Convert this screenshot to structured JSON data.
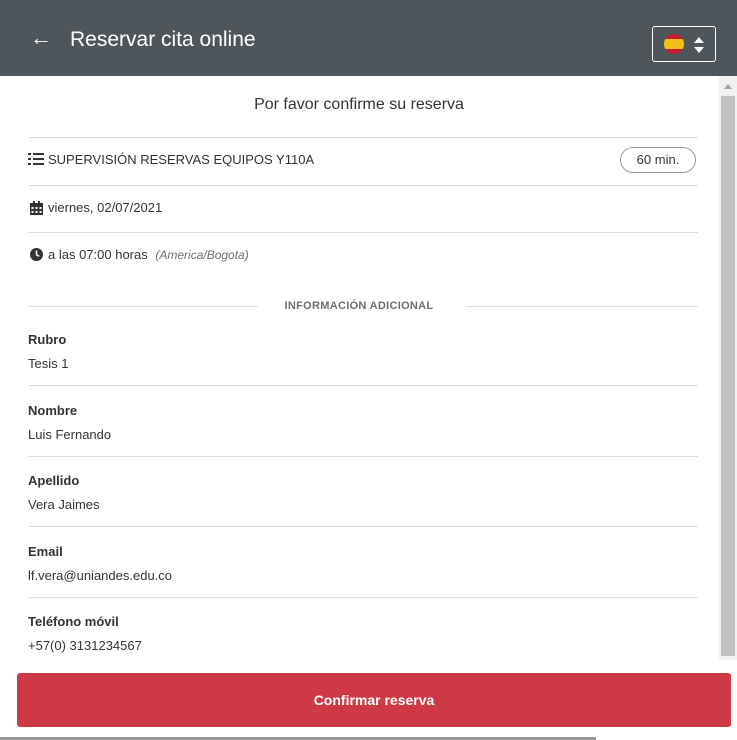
{
  "header": {
    "title": "Reservar cita online",
    "back_icon": "arrow-left-icon",
    "language_flag": "spain-flag-icon"
  },
  "confirmation": {
    "title": "Por favor confirme su reserva"
  },
  "appointment": {
    "service": "SUPERVISIÓN RESERVAS EQUIPOS Y110A",
    "duration": "60 min.",
    "date": "viernes, 02/07/2021",
    "time": "a las 07:00 horas",
    "timezone": "(America/Bogota)"
  },
  "additional_info": {
    "title": "INFORMACIÓN ADICIONAL",
    "fields": [
      {
        "label": "Rubro",
        "value": "Tesis 1"
      },
      {
        "label": "Nombre",
        "value": "Luis Fernando"
      },
      {
        "label": "Apellido",
        "value": "Vera Jaimes"
      },
      {
        "label": "Email",
        "value": "lf.vera@uniandes.edu.co"
      },
      {
        "label": "Teléfono móvil",
        "value": "+57(0) 3131234567"
      }
    ]
  },
  "actions": {
    "confirm_label": "Confirmar reserva"
  },
  "colors": {
    "header_bg": "#4f565b",
    "button_bg": "#cd3a45"
  }
}
